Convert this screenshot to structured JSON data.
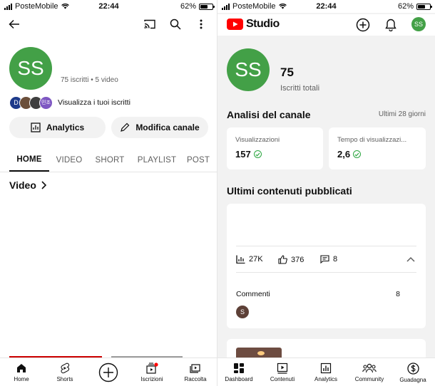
{
  "left": {
    "status": {
      "carrier": "PosteMobile",
      "time": "22:44",
      "battery": "62%",
      "battery_level": 0.62
    },
    "channel": {
      "avatar_initials": "SS",
      "avatar_color": "#43a047",
      "meta": "75 iscritti • 5 video",
      "subscribers_link": "Visualizza i tuoi iscritti",
      "subscriber_avatars": [
        {
          "initial": "D",
          "color": "#1e3a8a"
        },
        {
          "initial": "",
          "color": "#6b4f3a"
        },
        {
          "initial": "",
          "color": "#3f3f3f"
        },
        {
          "initial": "민조",
          "color": "#7e57c2"
        }
      ]
    },
    "buttons": {
      "analytics": "Analytics",
      "edit_channel": "Modifica canale"
    },
    "tabs": [
      "HOME",
      "VIDEO",
      "SHORT",
      "PLAYLIST",
      "POST"
    ],
    "active_tab": "HOME",
    "video_section": "Video",
    "bottom_nav": [
      "Home",
      "Shorts",
      "",
      "Iscrizioni",
      "Raccolta"
    ]
  },
  "right": {
    "status": {
      "carrier": "PosteMobile",
      "time": "22:44",
      "battery": "62%",
      "battery_level": 0.62
    },
    "app_title": "Studio",
    "avatar_initials": "SS",
    "subscriber_count": "75",
    "subscriber_label": "Iscritti totali",
    "analytics_title": "Analisi del canale",
    "period": "Ultimi 28 giorni",
    "cards": [
      {
        "label": "Visualizzazioni",
        "value": "157"
      },
      {
        "label": "Tempo di visualizzazi...",
        "value": "2,6"
      }
    ],
    "latest_title": "Ultimi contenuti pubblicati",
    "stats": {
      "views": "27K",
      "likes": "376",
      "comments": "8"
    },
    "comments_label": "Commenti",
    "comments_count": "8",
    "commenter_initial": "S",
    "bottom_nav": [
      "Dashboard",
      "Contenuti",
      "Analytics",
      "Community",
      "Guadagna"
    ]
  },
  "colors": {
    "brand_red": "#ff0000",
    "accent_green": "#2ba640",
    "avatar_green": "#43a047"
  }
}
